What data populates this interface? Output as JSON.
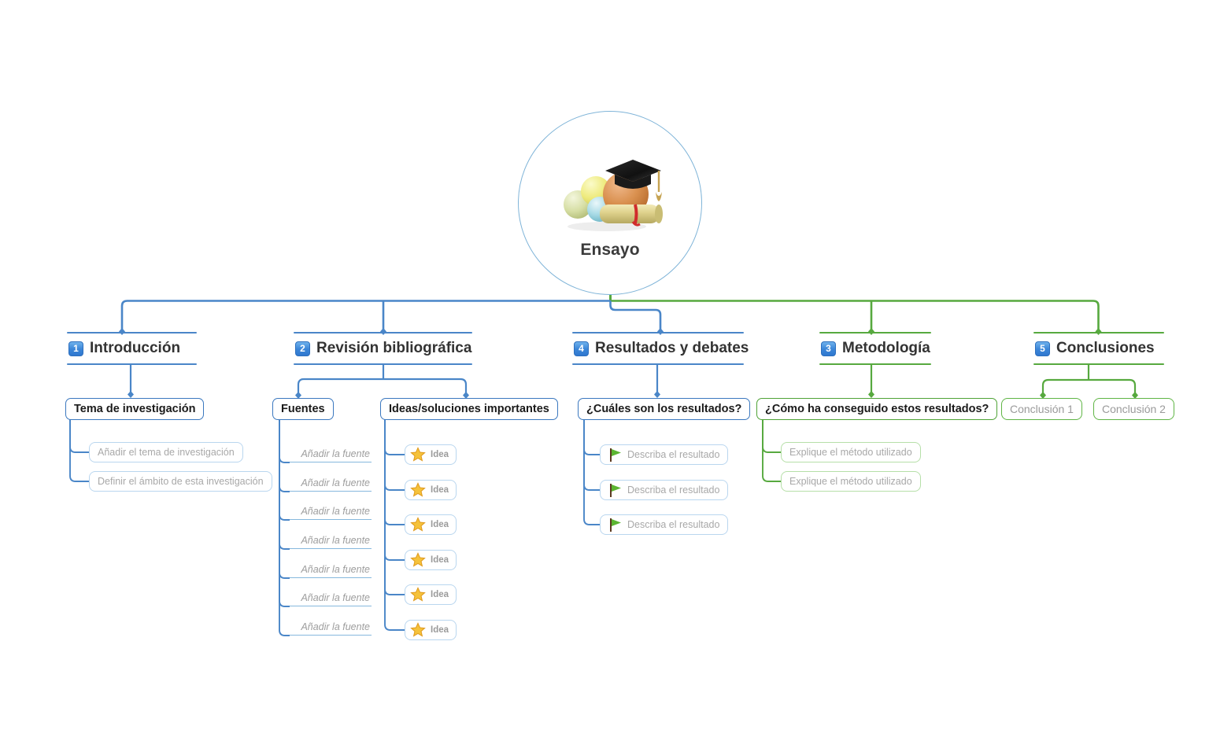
{
  "document": {
    "type": "mind-map",
    "language": "es",
    "root": {
      "label": "Ensayo",
      "icon": "graduation-cap-diploma-icon",
      "shape": "circle",
      "border_color": "#7fb4d8"
    }
  },
  "colors": {
    "blue_branch": "#4a86c8",
    "green_branch": "#57a93f",
    "badge_blue": "#3c86d8",
    "pill_blue_border": "#b9d6ef",
    "pill_green_border": "#b6dfa8",
    "placeholder_text": "#a8a8a8",
    "star_gold": "#f5c23b",
    "flag_green": "#5cb531"
  },
  "topics": [
    {
      "number": "1",
      "label": "Introducción",
      "color": "blue",
      "children": [
        {
          "label": "Tema de investigación",
          "style": "box",
          "children": [
            {
              "label": "Añadir el tema de investigación",
              "style": "pill",
              "icon": null
            },
            {
              "label": "Definir el ámbito de esta investigación",
              "style": "pill",
              "icon": null
            }
          ]
        }
      ]
    },
    {
      "number": "2",
      "label": "Revisión bibliográfica",
      "color": "blue",
      "children": [
        {
          "label": "Fuentes",
          "style": "box",
          "children": [
            {
              "label": "Añadir la fuente",
              "style": "underline",
              "icon": null
            },
            {
              "label": "Añadir la fuente",
              "style": "underline",
              "icon": null
            },
            {
              "label": "Añadir la fuente",
              "style": "underline",
              "icon": null
            },
            {
              "label": "Añadir la fuente",
              "style": "underline",
              "icon": null
            },
            {
              "label": "Añadir la fuente",
              "style": "underline",
              "icon": null
            },
            {
              "label": "Añadir la fuente",
              "style": "underline",
              "icon": null
            },
            {
              "label": "Añadir la fuente",
              "style": "underline",
              "icon": null
            }
          ]
        },
        {
          "label": "Ideas/soluciones importantes",
          "style": "box",
          "children": [
            {
              "label": "Idea",
              "style": "pill",
              "icon": "star-icon"
            },
            {
              "label": "Idea",
              "style": "pill",
              "icon": "star-icon"
            },
            {
              "label": "Idea",
              "style": "pill",
              "icon": "star-icon"
            },
            {
              "label": "Idea",
              "style": "pill",
              "icon": "star-icon"
            },
            {
              "label": "Idea",
              "style": "pill",
              "icon": "star-icon"
            },
            {
              "label": "Idea",
              "style": "pill",
              "icon": "star-icon"
            }
          ]
        }
      ]
    },
    {
      "number": "4",
      "label": "Resultados y debates",
      "color": "blue",
      "children": [
        {
          "label": "¿Cuáles son los resultados?",
          "style": "box",
          "children": [
            {
              "label": "Describa el resultado",
              "style": "pill",
              "icon": "flag-icon"
            },
            {
              "label": "Describa el resultado",
              "style": "pill",
              "icon": "flag-icon"
            },
            {
              "label": "Describa el resultado",
              "style": "pill",
              "icon": "flag-icon"
            }
          ]
        }
      ]
    },
    {
      "number": "3",
      "label": "Metodología",
      "color": "green",
      "children": [
        {
          "label": "¿Cómo ha conseguido estos resultados?",
          "style": "box",
          "children": [
            {
              "label": "Explique el método utilizado",
              "style": "pill",
              "icon": null
            },
            {
              "label": "Explique el método utilizado",
              "style": "pill",
              "icon": null
            }
          ]
        }
      ]
    },
    {
      "number": "5",
      "label": "Conclusiones",
      "color": "green",
      "children": [
        {
          "label": "Conclusión 1",
          "style": "pill-strong",
          "children": []
        },
        {
          "label": "Conclusión 2",
          "style": "pill-strong",
          "children": []
        }
      ]
    }
  ]
}
